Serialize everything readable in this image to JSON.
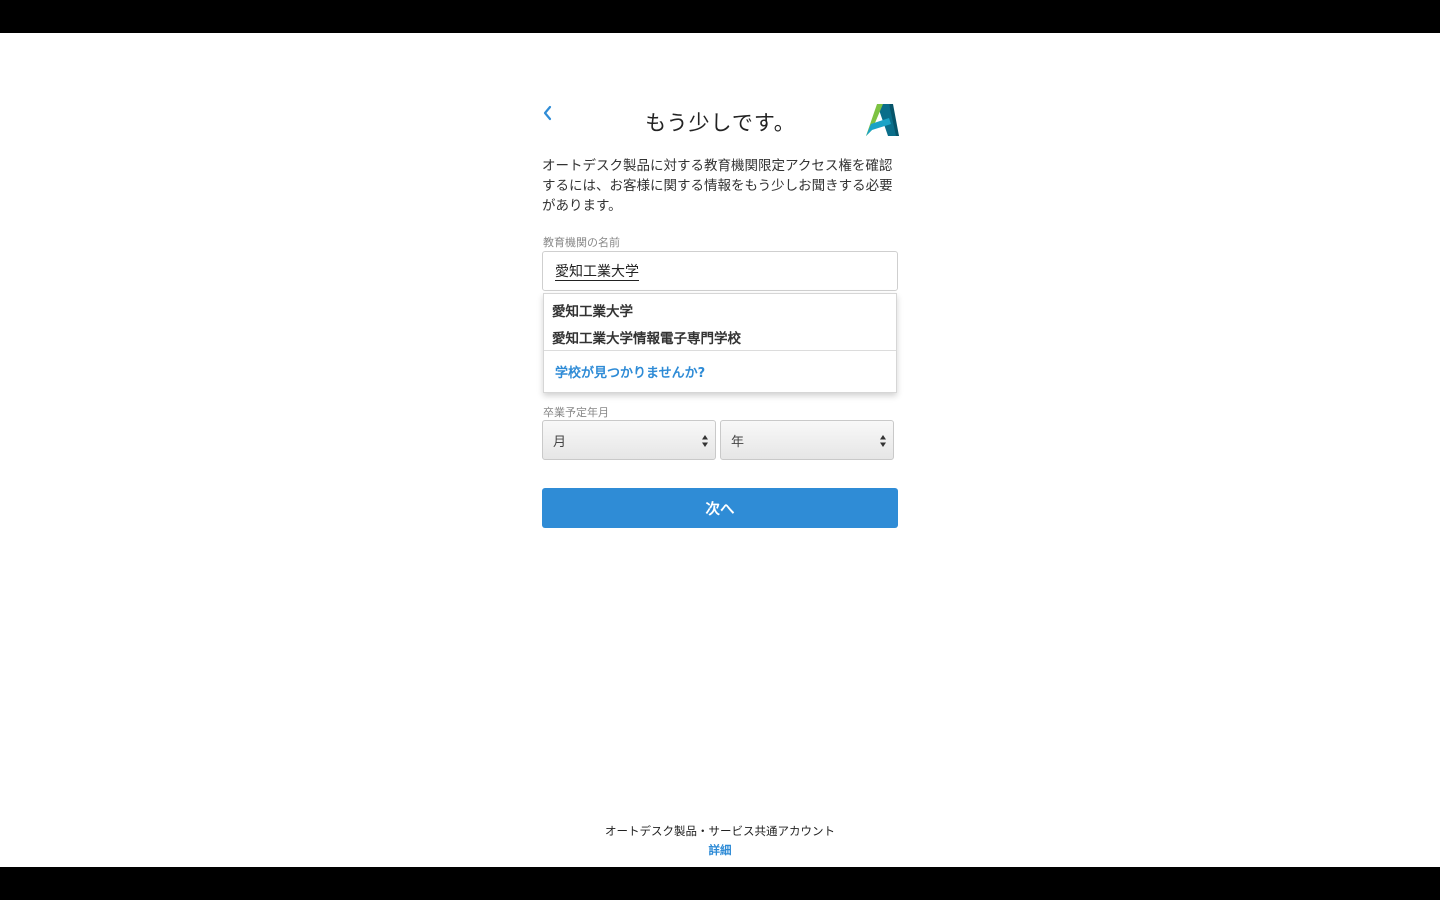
{
  "header": {
    "title": "もう少しです。",
    "back_icon": "chevron-left-icon",
    "logo_icon": "autodesk-logo-icon"
  },
  "description": "オートデスク製品に対する教育機関限定アクセス権を確認するには、お客様に関する情報をもう少しお聞きする必要があります。",
  "school": {
    "label": "教育機関の名前",
    "value": "愛知工業大学",
    "suggestions": [
      "愛知工業大学",
      "愛知工業大学情報電子専門学校"
    ],
    "not_found_link": "学校が見つかりませんか?"
  },
  "graduation": {
    "label": "卒業予定年月",
    "month_placeholder": "月",
    "year_placeholder": "年"
  },
  "next_button": "次へ",
  "footer": {
    "text": "オートデスク製品・サービス共通アカウント",
    "link": "詳細"
  },
  "colors": {
    "accent": "#2f8cd6",
    "text": "#333333",
    "label": "#888888"
  }
}
